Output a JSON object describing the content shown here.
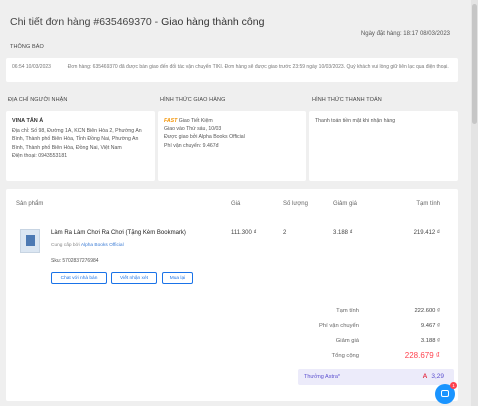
{
  "header": {
    "title_prefix": "Chi tiết đơn hàng #",
    "order_number": "635469370",
    "separator": " - ",
    "status": "Giao hàng thành công",
    "order_date": "Ngày đặt hàng: 18:17 08/03/2023"
  },
  "notice": {
    "section_label": "THÔNG BÁO",
    "time": "06:54 10/03/2023",
    "message": "Đơn hàng: 635469370 đã được bàn giao đến đối tác vận chuyển TIKI. Đơn hàng sẽ được giao trước 23:59 ngày 10/03/2023. Quý khách vui lòng giữ liên lạc qua điện thoại."
  },
  "address": {
    "section_label": "ĐỊA CHỈ NGƯỜI NHẬN",
    "name": "VINA TÂN Á",
    "address_line": "Địa chỉ: Số 98, Đường 1A, KCN Biên Hòa 2, Phường An Bình, Thành phố Biên Hòa, Tỉnh Đồng Nai, Phường An Bình, Thành phố Biên Hòa, Đồng Nai, Việt Nam",
    "phone": "Điện thoại: 0943553181"
  },
  "shipping": {
    "section_label": "HÌNH THỨC GIAO HÀNG",
    "fast_badge": "FAST",
    "carrier": "Giao Tiết Kiệm",
    "delivery_date": "Giao vào Thứ sáu, 10/03",
    "provider": "Được giao bởi Alpha Books Official",
    "fee": "Phí vận chuyển: 9.467đ"
  },
  "payment": {
    "section_label": "HÌNH THỨC THANH TOÁN",
    "method": "Thanh toán tiền mặt khi nhận hàng"
  },
  "products": {
    "columns": {
      "product": "Sản phẩm",
      "price": "Giá",
      "quantity": "Số lượng",
      "discount": "Giảm giá",
      "subtotal": "Tạm tính"
    },
    "items": [
      {
        "name": "Làm Ra Làm Chơi Ra Chơi (Tặng Kèm Bookmark)",
        "seller_prefix": "Cung cấp bởi ",
        "seller": "Alpha Books Official",
        "sku": "Sku: 5702837276984",
        "price": "111.300 ₫",
        "quantity": "2",
        "discount": "3.188 ₫",
        "subtotal": "219.412 ₫",
        "buttons": [
          "Chat với nhà bán",
          "Viết nhận xét",
          "Mua lại"
        ]
      }
    ]
  },
  "summary": {
    "rows": [
      {
        "label": "Tạm tính",
        "value": "222.600 ₫"
      },
      {
        "label": "Phí vận chuyển",
        "value": "9.467 ₫"
      },
      {
        "label": "Giảm giá",
        "value": "3.188 ₫"
      }
    ],
    "total_label": "Tổng cộng",
    "total_value": "228.679 ₫",
    "astra_label": "Thưởng Astra*",
    "astra_value": "3,29",
    "astra_logo": "A"
  },
  "chat": {
    "badge_count": "1"
  },
  "colors": {
    "accent": "#1a73e8",
    "total_red": "#ff424e",
    "fast_orange": "#f39200",
    "astra_purple": "#5b4fcf"
  }
}
